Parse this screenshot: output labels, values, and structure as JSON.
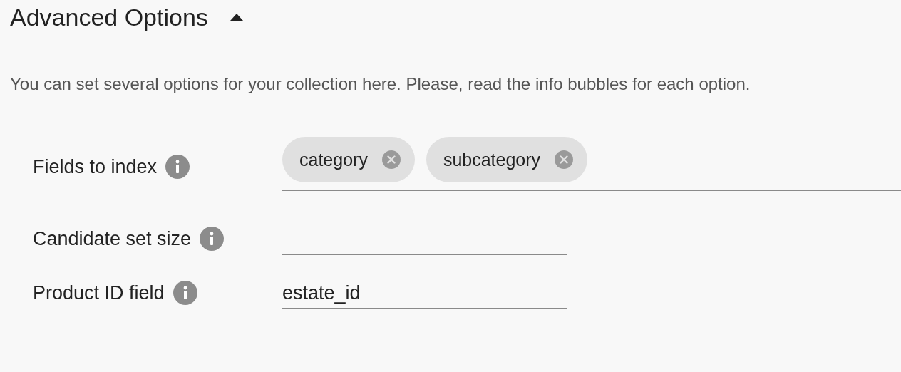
{
  "section": {
    "title": "Advanced Options",
    "expanded": true
  },
  "description": "You can set several options for your collection here. Please, read the info bubbles for each option.",
  "fields": [
    {
      "kind": "chips",
      "label": "Fields to index",
      "chips": [
        "category",
        "subcategory"
      ]
    },
    {
      "kind": "text",
      "label": "Candidate set size"
    },
    {
      "kind": "text",
      "label": "Product ID field",
      "value": "estate_id"
    }
  ]
}
